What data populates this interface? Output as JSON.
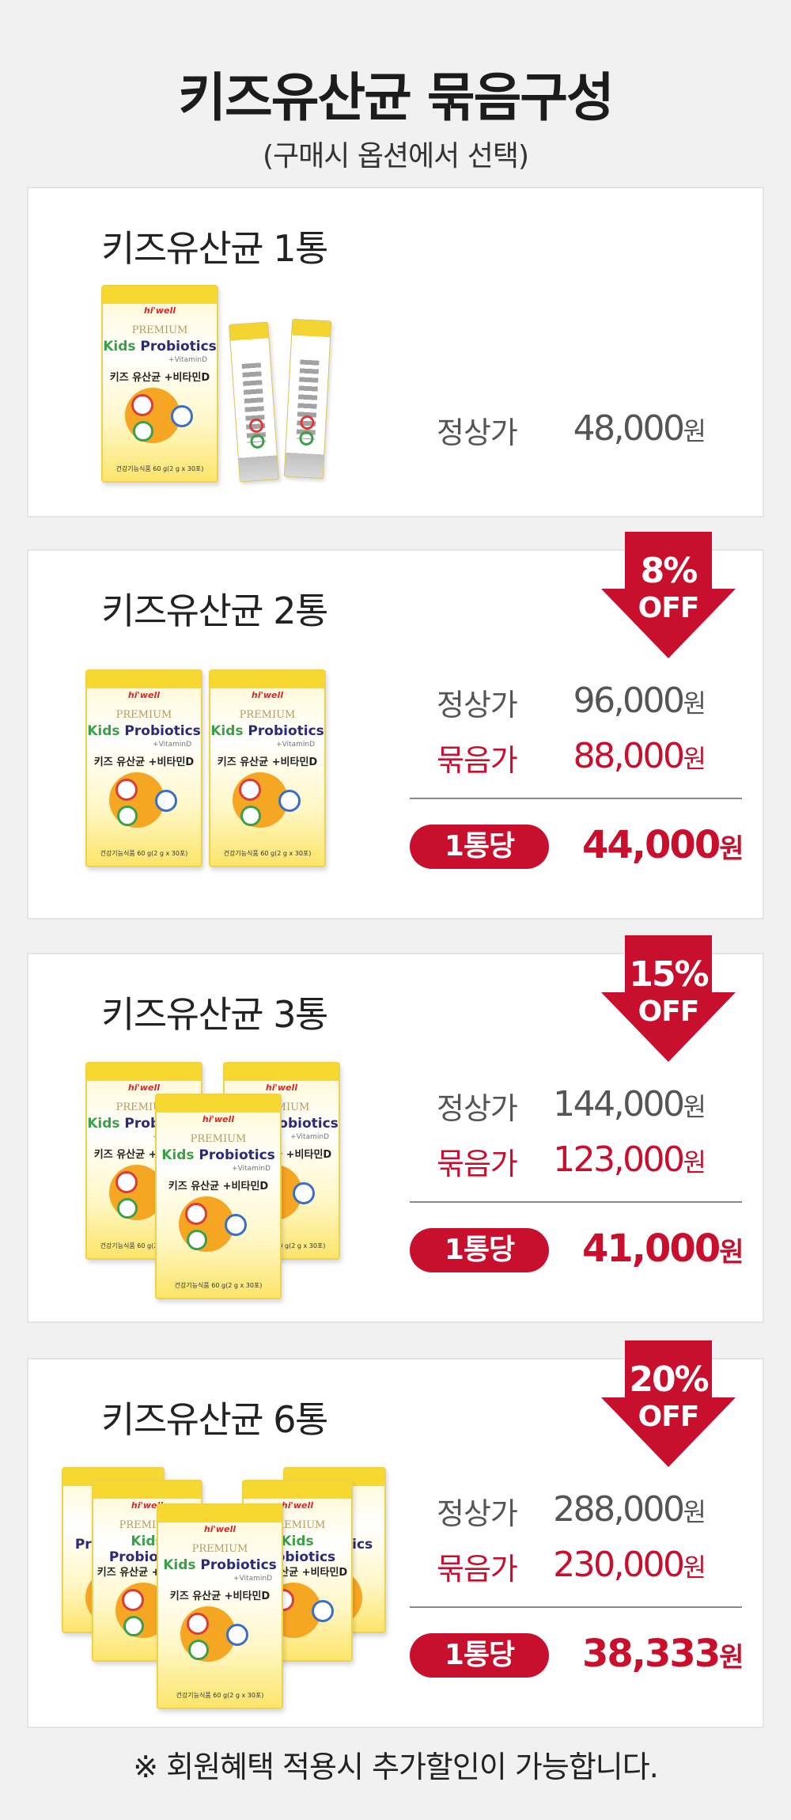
{
  "header": {
    "title": "키즈유산균 묶음구성",
    "subtitle": "(구매시 옵션에서 선택)"
  },
  "product_box": {
    "brand": "hi'well",
    "premium": "PREMIUM",
    "name_en_prefix": "Kids",
    "name_en": " Probiotics",
    "vitamin": "+VitaminD",
    "name_kr": "키즈 유산균 +비타민D",
    "footer": "건강기능식품 60 g(2 g x 30포)"
  },
  "labels": {
    "regular_price": "정상가",
    "bundle_price": "묶음가",
    "per_unit": "1통당",
    "off": "OFF"
  },
  "options": [
    {
      "title": "키즈유산균 1통",
      "regular_price": "48,000",
      "currency": "원"
    },
    {
      "title": "키즈유산균 2통",
      "discount": "8%",
      "regular_price": "96,000",
      "bundle_price": "88,000",
      "unit_price": "44,000",
      "currency": "원"
    },
    {
      "title": "키즈유산균 3통",
      "discount": "15%",
      "regular_price": "144,000",
      "bundle_price": "123,000",
      "unit_price": "41,000",
      "currency": "원"
    },
    {
      "title": "키즈유산균 6통",
      "discount": "20%",
      "regular_price": "288,000",
      "bundle_price": "230,000",
      "unit_price": "38,333",
      "currency": "원"
    }
  ],
  "footnote": "※ 회원혜택 적용시 추가할인이 가능합니다.",
  "colors": {
    "accent": "#c8102e",
    "background": "#f1f1f1",
    "box_yellow": "#f6d831"
  }
}
